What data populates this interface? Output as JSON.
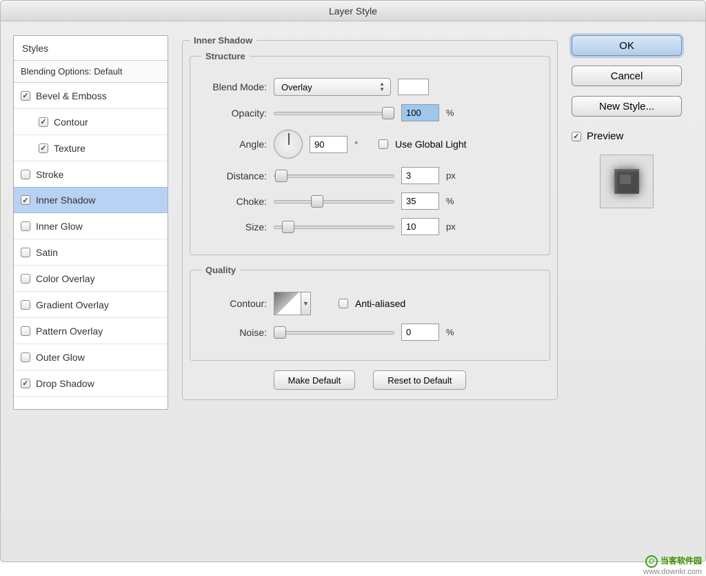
{
  "window": {
    "title": "Layer Style"
  },
  "sidebar": {
    "header": "Styles",
    "blending": "Blending Options: Default",
    "items": [
      {
        "label": "Bevel & Emboss",
        "checked": true,
        "indent": false
      },
      {
        "label": "Contour",
        "checked": true,
        "indent": true
      },
      {
        "label": "Texture",
        "checked": true,
        "indent": true
      },
      {
        "label": "Stroke",
        "checked": false,
        "indent": false
      },
      {
        "label": "Inner Shadow",
        "checked": true,
        "indent": false,
        "selected": true
      },
      {
        "label": "Inner Glow",
        "checked": false,
        "indent": false
      },
      {
        "label": "Satin",
        "checked": false,
        "indent": false
      },
      {
        "label": "Color Overlay",
        "checked": false,
        "indent": false
      },
      {
        "label": "Gradient Overlay",
        "checked": false,
        "indent": false
      },
      {
        "label": "Pattern Overlay",
        "checked": false,
        "indent": false
      },
      {
        "label": "Outer Glow",
        "checked": false,
        "indent": false
      },
      {
        "label": "Drop Shadow",
        "checked": true,
        "indent": false
      }
    ]
  },
  "panel": {
    "title": "Inner Shadow",
    "structure": {
      "legend": "Structure",
      "blendModeLabel": "Blend Mode:",
      "blendModeValue": "Overlay",
      "opacityLabel": "Opacity:",
      "opacityValue": "100",
      "opacityUnit": "%",
      "angleLabel": "Angle:",
      "angleValue": "90",
      "angleUnit": "°",
      "useGlobalLabel": "Use Global Light",
      "distanceLabel": "Distance:",
      "distanceValue": "3",
      "distanceUnit": "px",
      "chokeLabel": "Choke:",
      "chokeValue": "35",
      "chokeUnit": "%",
      "sizeLabel": "Size:",
      "sizeValue": "10",
      "sizeUnit": "px"
    },
    "quality": {
      "legend": "Quality",
      "contourLabel": "Contour:",
      "antiAliasedLabel": "Anti-aliased",
      "noiseLabel": "Noise:",
      "noiseValue": "0",
      "noiseUnit": "%"
    },
    "buttons": {
      "makeDefault": "Make Default",
      "resetDefault": "Reset to Default"
    }
  },
  "right": {
    "ok": "OK",
    "cancel": "Cancel",
    "newStyle": "New Style...",
    "preview": "Preview"
  },
  "watermark": {
    "cn": "当客软件园",
    "url": "www.downkr.com"
  }
}
